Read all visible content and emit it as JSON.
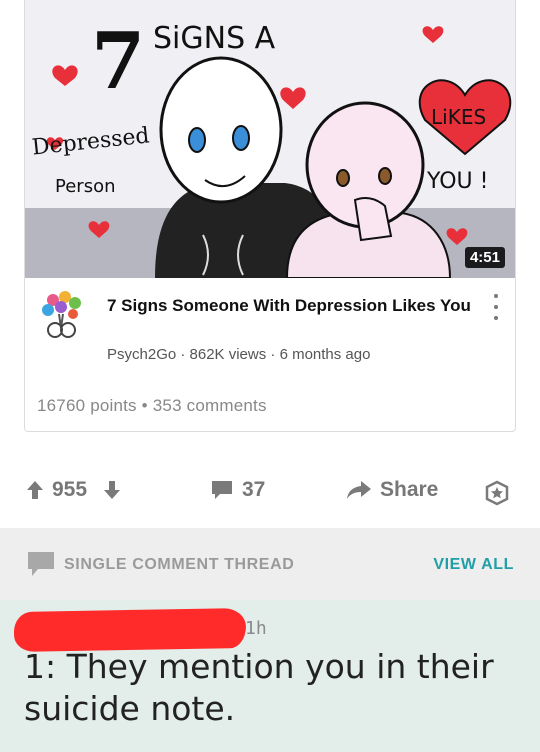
{
  "video": {
    "thumbnail_text": {
      "number": "7",
      "signs_a": "SiGNS  A",
      "depressed": "Depressed",
      "person": "Person",
      "likes": "LiKES",
      "you": "YOU !"
    },
    "duration": "4:51",
    "title": "7 Signs Someone With Depression Likes You",
    "meta": "Psych2Go · 862K views · 6 months ago",
    "channel_avatar_icon": "psych2go-tree-logo-icon"
  },
  "card_stats": "16760 points • 353 comments",
  "actions": {
    "upvotes": "955",
    "comments": "37",
    "share_label": "Share",
    "upvote_icon": "arrow-up-icon",
    "downvote_icon": "arrow-down-icon",
    "comment_icon": "comment-bubble-icon",
    "share_icon": "share-arrow-icon",
    "award_icon": "award-star-icon"
  },
  "thread": {
    "label": "SINGLE COMMENT THREAD",
    "view_all": "VIEW ALL",
    "icon": "speech-bubble-icon"
  },
  "comment": {
    "timestamp": "1h",
    "text": "1: They mention you in their suicide note."
  },
  "colors": {
    "accent": "#1f9fa8",
    "comment_bg": "#e3eeea",
    "band_bg": "#eeeeee",
    "heart": "#e8303a",
    "redaction": "#ff2a2a"
  }
}
